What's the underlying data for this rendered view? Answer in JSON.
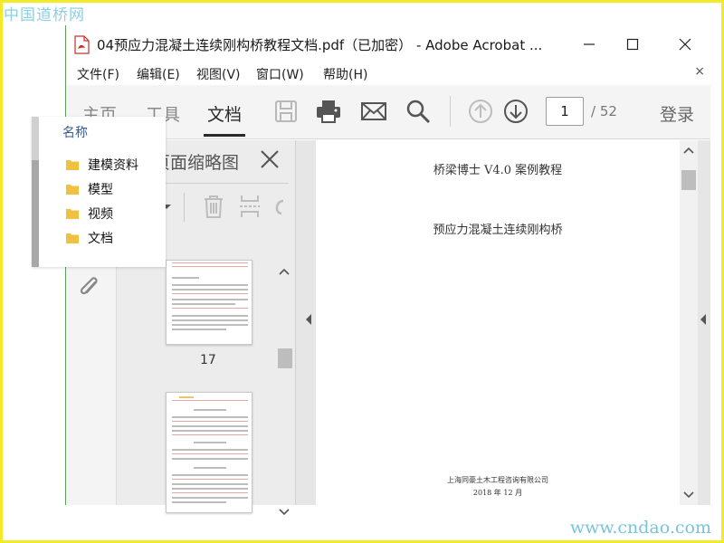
{
  "watermarks": {
    "top": "中国道桥网",
    "bottom": "www.cndao.com"
  },
  "window": {
    "title": "04预应力混凝土连续刚构桥教程文档.pdf（已加密） - Adobe Acrobat ...",
    "border_color": "#5aa05a"
  },
  "menu": {
    "items": [
      "文件(F)",
      "编辑(E)",
      "视图(V)",
      "窗口(W)",
      "帮助(H)"
    ],
    "close": "×"
  },
  "toolbar": {
    "tabs": [
      "主页",
      "工具",
      "文档"
    ],
    "active_tab": "文档",
    "icons": [
      "save-icon",
      "print-icon",
      "email-icon",
      "search-icon",
      "arrow-up-circle-icon",
      "arrow-down-circle-icon"
    ],
    "page_current": "1",
    "page_total": "/ 52",
    "login": "登录"
  },
  "sidebar": {
    "icons": [
      "paperclip-icon"
    ]
  },
  "thumbnails": {
    "title": "页面缩略图",
    "pages": [
      {
        "label": "17"
      }
    ]
  },
  "document": {
    "title1": "桥梁博士 V4.0 案例教程",
    "title2": "预应力混凝土连续刚构桥",
    "company": "上海同豪土木工程咨询有限公司",
    "date": "2018 年 12 月"
  },
  "explorer": {
    "header": "名称",
    "folders": [
      {
        "label": "建模资料"
      },
      {
        "label": "模型"
      },
      {
        "label": "视频"
      },
      {
        "label": "文档"
      }
    ],
    "folder_color": "#f0c040"
  },
  "colors": {
    "frame": "#f3ea2a",
    "watermark": "#7fc7de"
  }
}
